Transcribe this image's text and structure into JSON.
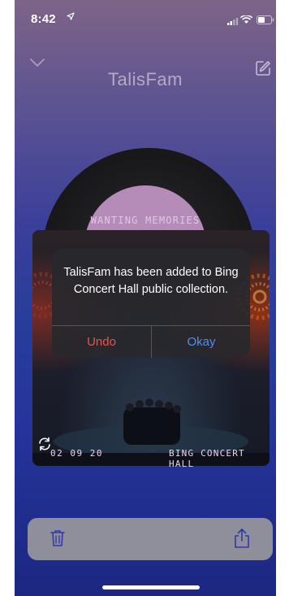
{
  "status_bar": {
    "time": "8:42",
    "location_icon": "location-arrow-icon"
  },
  "header": {
    "title": "TalisFam",
    "collapse_icon": "chevron-down-icon",
    "edit_icon": "edit-icon"
  },
  "record": {
    "song_title": "WANTING MEMORIES"
  },
  "photo": {
    "date": "02 09 20",
    "location": "BING CONCERT HALL",
    "refresh_icon": "refresh-icon"
  },
  "alert": {
    "message": "TalisFam has been added to Bing Concert Hall public collection.",
    "undo_label": "Undo",
    "okay_label": "Okay",
    "undo_color": "#e8534a",
    "okay_color": "#4f8ff2"
  },
  "bottom_bar": {
    "trash_icon": "trash-icon",
    "share_icon": "share-icon"
  }
}
